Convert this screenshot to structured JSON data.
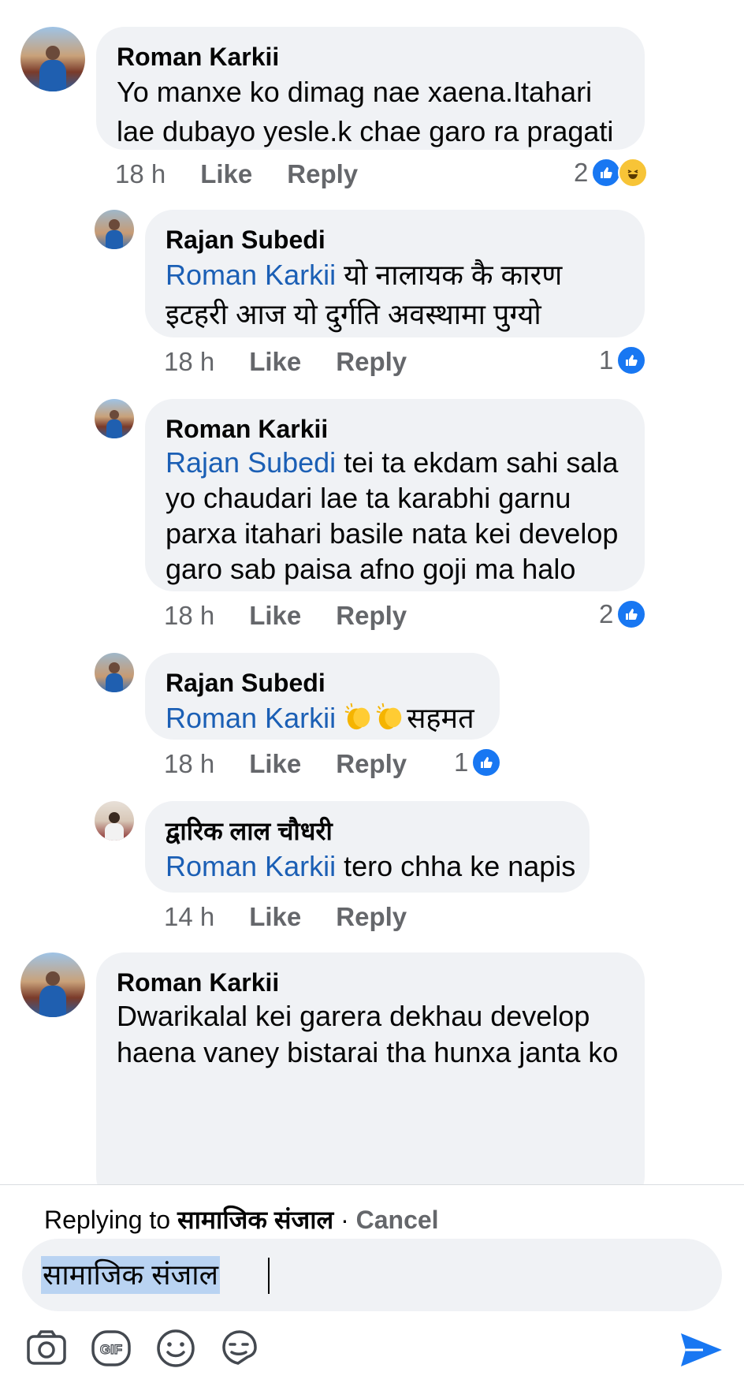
{
  "comments": [
    {
      "author": "Roman Karkii",
      "text": "Yo manxe ko dimag nae xaena.Itahari lae dubayo yesle.k chae garo ra pragati",
      "time": "18 h",
      "like_label": "Like",
      "reply_label": "Reply",
      "reaction_count": "2",
      "reactions": [
        "like-icon",
        "haha-icon"
      ]
    },
    {
      "author": "Rajan Subedi",
      "mention": "Roman Karkii",
      "text": "यो नालायक कै कारण इटहरी आज यो दुर्गति अवस्थामा पुग्यो",
      "time": "18 h",
      "like_label": "Like",
      "reply_label": "Reply",
      "reaction_count": "1",
      "reactions": [
        "like-icon"
      ]
    },
    {
      "author": "Roman Karkii",
      "mention": "Rajan Subedi",
      "text": "tei ta ekdam sahi sala yo chaudari lae ta karabhi garnu parxa itahari basile nata kei develop garo sab paisa afno goji ma halo",
      "time": "18 h",
      "like_label": "Like",
      "reply_label": "Reply",
      "reaction_count": "2",
      "reactions": [
        "like-icon"
      ]
    },
    {
      "author": "Rajan Subedi",
      "mention": "Roman Karkii",
      "text": "सहमत",
      "emoji": [
        "clapping-hands-emoji",
        "clapping-hands-emoji"
      ],
      "time": "18 h",
      "like_label": "Like",
      "reply_label": "Reply",
      "reaction_count": "1",
      "reactions": [
        "like-icon"
      ]
    },
    {
      "author": "द्वारिक लाल चौधरी",
      "mention": "Roman Karkii",
      "text": "tero chha ke napis",
      "time": "14 h",
      "like_label": "Like",
      "reply_label": "Reply"
    },
    {
      "author": "Roman Karkii",
      "text": "Dwarikalal kei garera dekhau develop haena vaney bistarai tha hunxa janta ko"
    }
  ],
  "composer": {
    "replying_prefix": "Replying to",
    "replying_to": "सामाजिक संजाल",
    "separator": "·",
    "cancel_label": "Cancel",
    "input_value": "सामाजिक संजाल",
    "tools": [
      "camera-icon",
      "gif-icon",
      "emoji-icon",
      "sticker-icon",
      "send-icon"
    ]
  },
  "colors": {
    "accent": "#1877f2",
    "mention": "#1b5fb5",
    "bubble": "#f0f2f5",
    "meta": "#65676b"
  }
}
